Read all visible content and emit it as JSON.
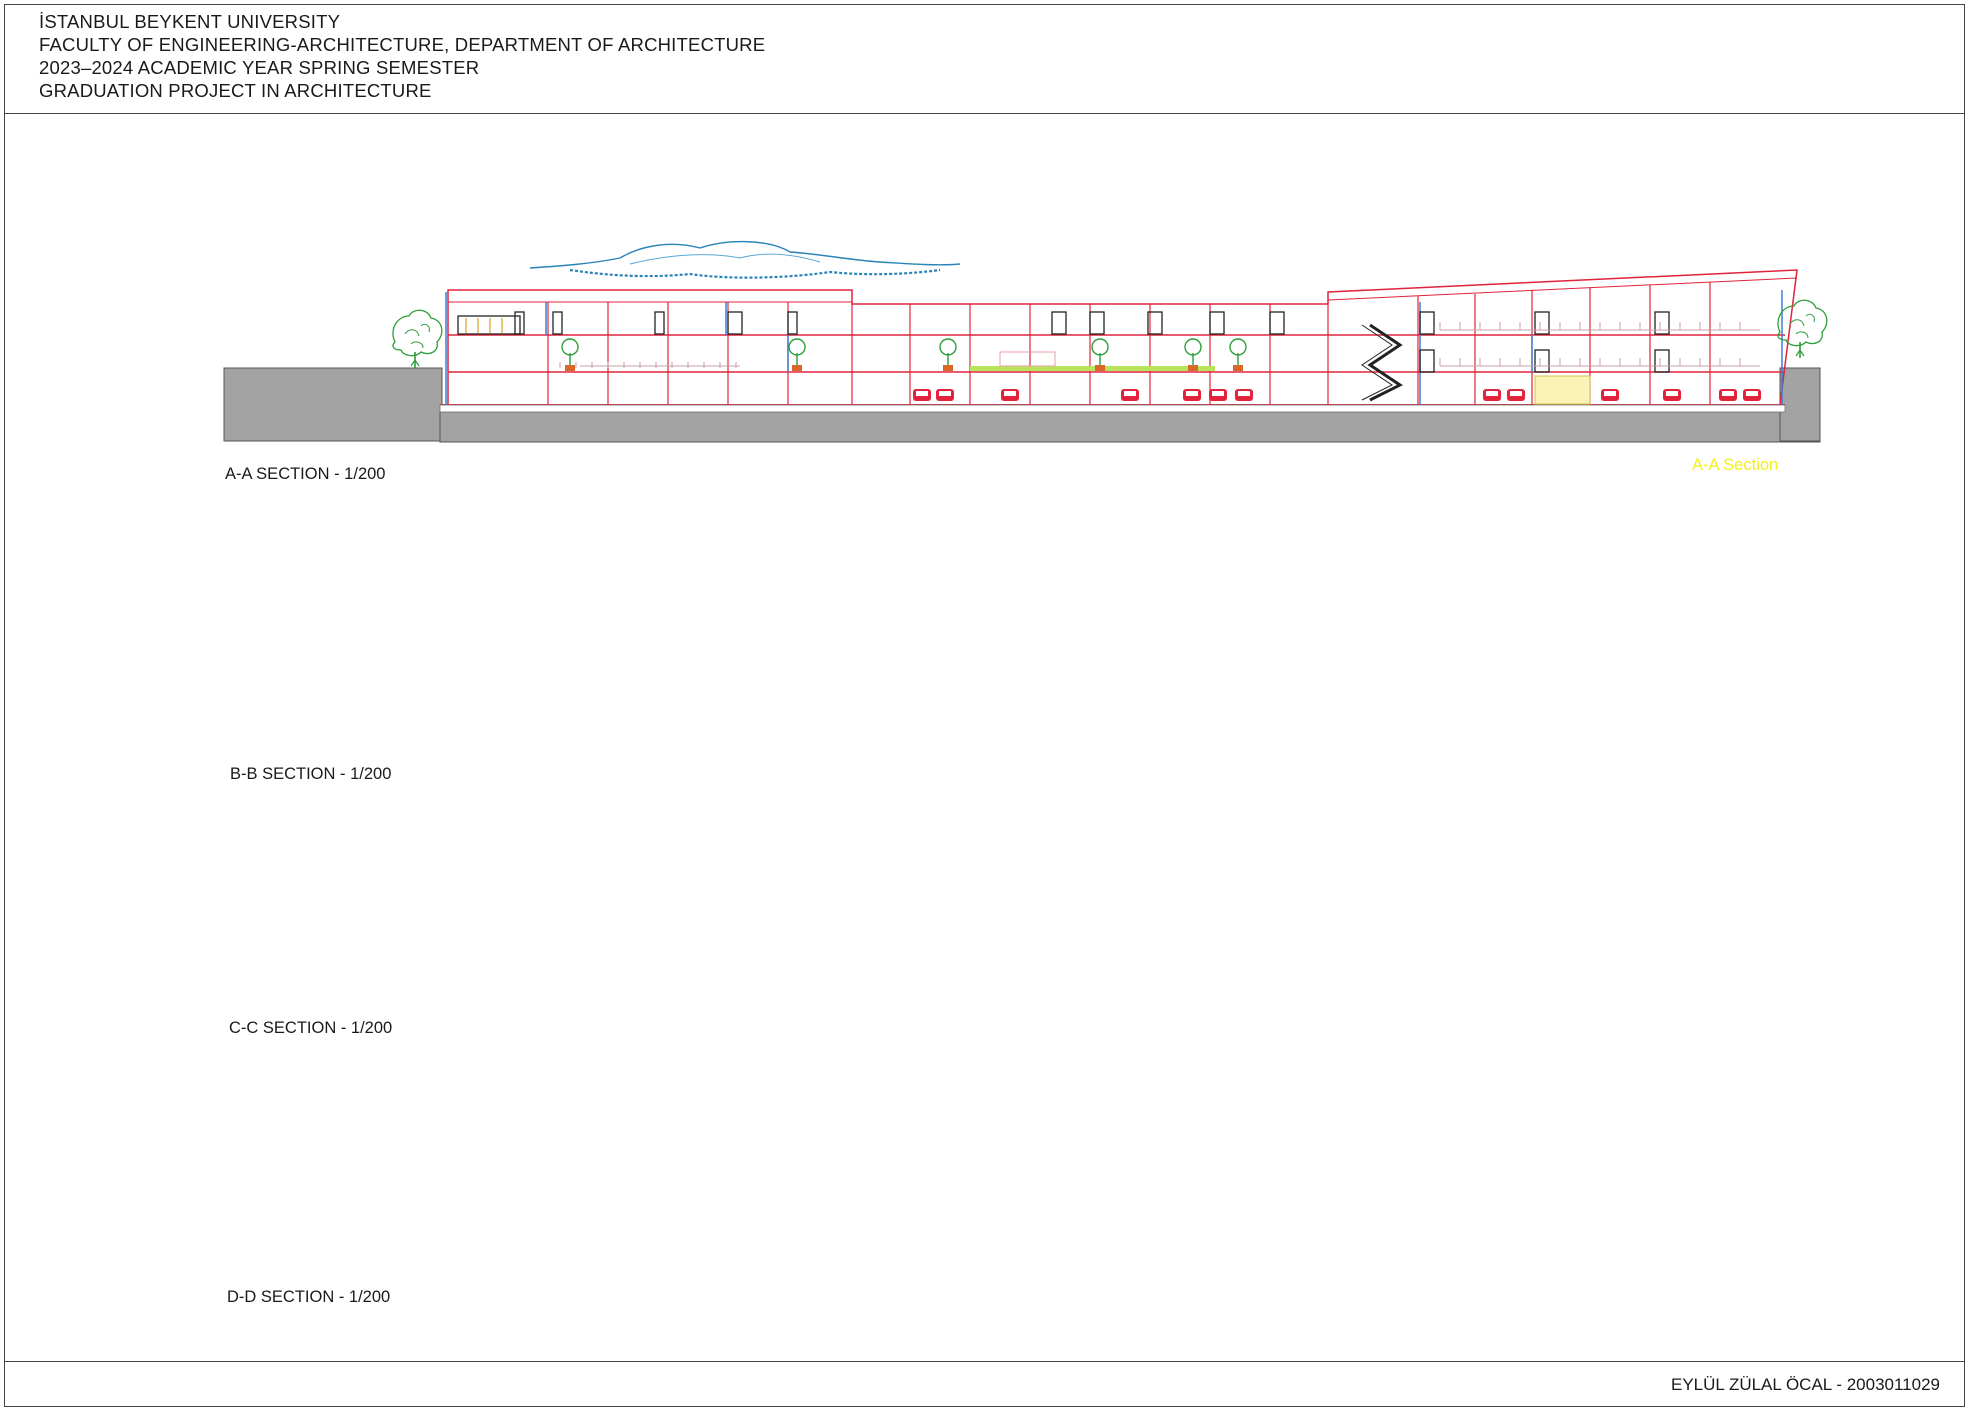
{
  "header": {
    "lines": [
      "İSTANBUL BEYKENT UNIVERSITY",
      "FACULTY OF ENGINEERING-ARCHITECTURE, DEPARTMENT OF ARCHITECTURE",
      "2023–2024 ACADEMIC YEAR SPRING SEMESTER",
      "GRADUATION PROJECT IN ARCHITECTURE"
    ]
  },
  "sections": {
    "a": {
      "label": "A-A SECTION - 1/200",
      "tag": "A-A Section"
    },
    "b": {
      "label": "B-B  SECTION - 1/200"
    },
    "c": {
      "label": "C-C  SECTION - 1/200"
    },
    "d": {
      "label": "D-D  SECTION - 1/200"
    }
  },
  "footer": {
    "author": "EYLÜL ZÜLAL ÖCAL - 2003011029"
  },
  "colors": {
    "ground": "#a3a3a3",
    "slab_red": "#e2233b",
    "column_olive": "#9c9a1f",
    "glass_blue": "#3a8fd6",
    "tree_green": "#2e9e3a",
    "cloud_blue": "#2a83b8",
    "facade_olive": "#b8b43a",
    "tag_yellow": "#f3f01a"
  }
}
